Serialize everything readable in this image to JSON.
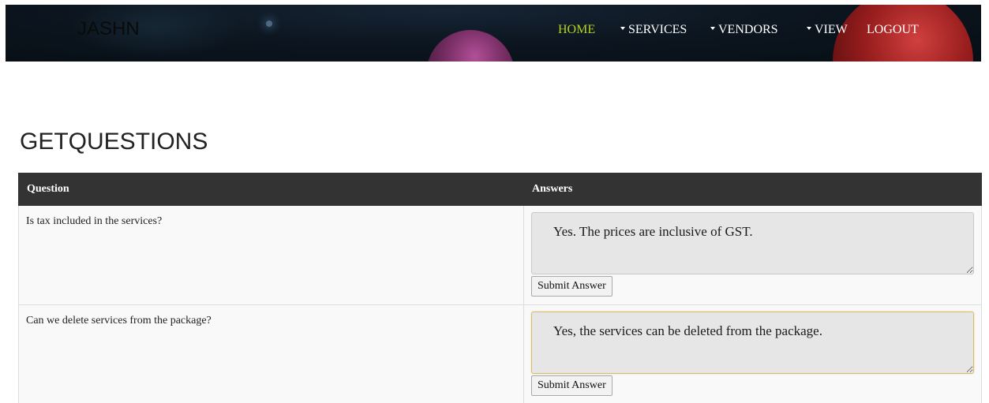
{
  "header": {
    "brand": "JASHN",
    "nav": [
      {
        "label": "HOME",
        "active": true,
        "dropdown": false
      },
      {
        "label": "SERVICES",
        "active": false,
        "dropdown": true
      },
      {
        "label": "VENDORS",
        "active": false,
        "dropdown": true
      },
      {
        "label": "VIEW",
        "active": false,
        "dropdown": true
      },
      {
        "label": "LOGOUT",
        "active": false,
        "dropdown": false
      }
    ],
    "colors": {
      "active_nav": "#b5d11b",
      "nav_text": "#ffffff"
    }
  },
  "main": {
    "title": "GETQUESTIONS",
    "table": {
      "headers": [
        "Question",
        "Answers"
      ],
      "rows": [
        {
          "question": "Is tax included in the services?",
          "answer": "Yes. The prices are inclusive of GST.",
          "submit_label": "Submit Answer",
          "focused": false
        },
        {
          "question": "Can we delete services from the package?",
          "answer": "Yes, the services can be deleted from the package.",
          "submit_label": "Submit Answer",
          "focused": true
        }
      ]
    },
    "colors": {
      "table_header_bg": "#333333",
      "row_bg": "#f9f9f9",
      "textarea_bg": "#e6e6e6",
      "focus_border": "#d6bd6d"
    }
  }
}
